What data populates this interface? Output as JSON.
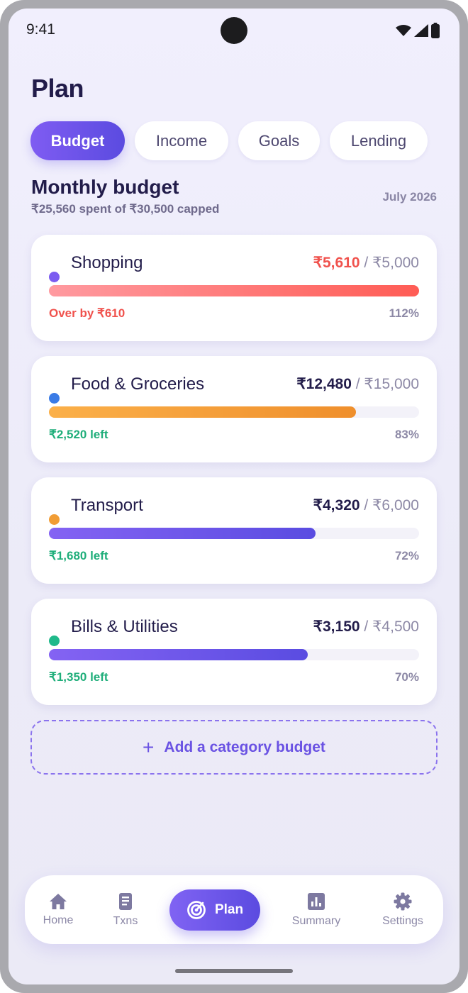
{
  "status_bar": {
    "time": "9:41"
  },
  "header": {
    "title": "Plan"
  },
  "tabs": [
    {
      "label": "Budget",
      "active": true
    },
    {
      "label": "Income",
      "active": false
    },
    {
      "label": "Goals",
      "active": false
    },
    {
      "label": "Lending",
      "active": false
    }
  ],
  "section": {
    "title": "Monthly budget",
    "subtitle": "₹25,560 spent of ₹30,500 capped",
    "period": "July 2026"
  },
  "budgets": [
    {
      "name": "Shopping",
      "spent": "₹5,610",
      "cap": "/ ₹5,000",
      "status": "Over by ₹610",
      "percent": "112%",
      "progress": 1.0,
      "dot_color": "#7b5cf0",
      "bar_from": "#ff9aa0",
      "bar_to": "#ff5c55",
      "status_color": "#f0524d",
      "spent_color": "#f0524d"
    },
    {
      "name": "Food & Groceries",
      "spent": "₹12,480",
      "cap": "/ ₹15,000",
      "status": "₹2,520 left",
      "percent": "83%",
      "progress": 0.83,
      "dot_color": "#3a7be6",
      "bar_from": "#fbb049",
      "bar_to": "#ef8f2c",
      "status_color": "#1fae7a",
      "spent_color": "#221c4a"
    },
    {
      "name": "Transport",
      "spent": "₹4,320",
      "cap": "/ ₹6,000",
      "status": "₹1,680 left",
      "percent": "72%",
      "progress": 0.72,
      "dot_color": "#f19d35",
      "bar_from": "#8463f3",
      "bar_to": "#5a4ce1",
      "status_color": "#1fae7a",
      "spent_color": "#221c4a"
    },
    {
      "name": "Bills & Utilities",
      "spent": "₹3,150",
      "cap": "/ ₹4,500",
      "status": "₹1,350 left",
      "percent": "70%",
      "progress": 0.7,
      "dot_color": "#1fb98a",
      "bar_from": "#8463f3",
      "bar_to": "#5a4ce1",
      "status_color": "#1fae7a",
      "spent_color": "#221c4a"
    }
  ],
  "add_button": {
    "icon": "plus-icon",
    "label": "Add a category budget"
  },
  "nav": {
    "items": [
      {
        "label": "Home",
        "icon": "home-icon"
      },
      {
        "label": "Txns",
        "icon": "receipt-icon"
      },
      {
        "label": "Plan",
        "icon": "target-icon",
        "active": true
      },
      {
        "label": "Summary",
        "icon": "chart-icon"
      },
      {
        "label": "Settings",
        "icon": "gear-icon"
      }
    ]
  }
}
